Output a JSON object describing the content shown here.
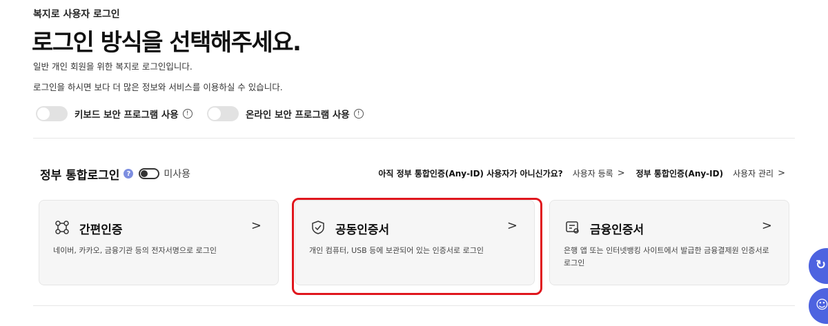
{
  "breadcrumb": "복지로 사용자 로그인",
  "title": "로그인 방식을 선택해주세요.",
  "desc1": "일반 개인 회원을 위한 복지로 로그인입니다.",
  "desc2": "로그인을 하시면 보다 더 많은 정보와 서비스를 이용하실 수 있습니다.",
  "toggles": [
    {
      "label": "키보드 보안 프로그램 사용",
      "on": false,
      "info_icon": "info-icon"
    },
    {
      "label": "온라인 보안 프로그램 사용",
      "on": false,
      "info_icon": "info-icon"
    }
  ],
  "section": {
    "title": "정부 통합로그인",
    "help": "?",
    "switch_label": "미사용",
    "prompt": "아직 정부 통합인증(Any-ID) 사용자가 아니신가요?",
    "register_link": "사용자 등록",
    "anyid_label": "정부 통합인증(Any-ID)",
    "manage_link": "사용자 관리",
    "chevron": ">"
  },
  "cards": [
    {
      "title": "간편인증",
      "desc": "네이버, 카카오, 금융기관 등의 전자서명으로 로그인",
      "icon": "link-nodes-icon",
      "chevron": ">"
    },
    {
      "title": "공동인증서",
      "desc": "개인 컴퓨터, USB 등에 보관되어 있는 인증서로 로그인",
      "icon": "shield-check-icon",
      "chevron": ">"
    },
    {
      "title": "금융인증서",
      "desc": "은행 앱 또는 인터넷뱅킹 사이트에서 발급한 금융결제원 인증서로 로그인",
      "icon": "certificate-icon",
      "chevron": ">"
    }
  ],
  "highlight_color": "#e0161d",
  "accent_color": "#4d63e0"
}
